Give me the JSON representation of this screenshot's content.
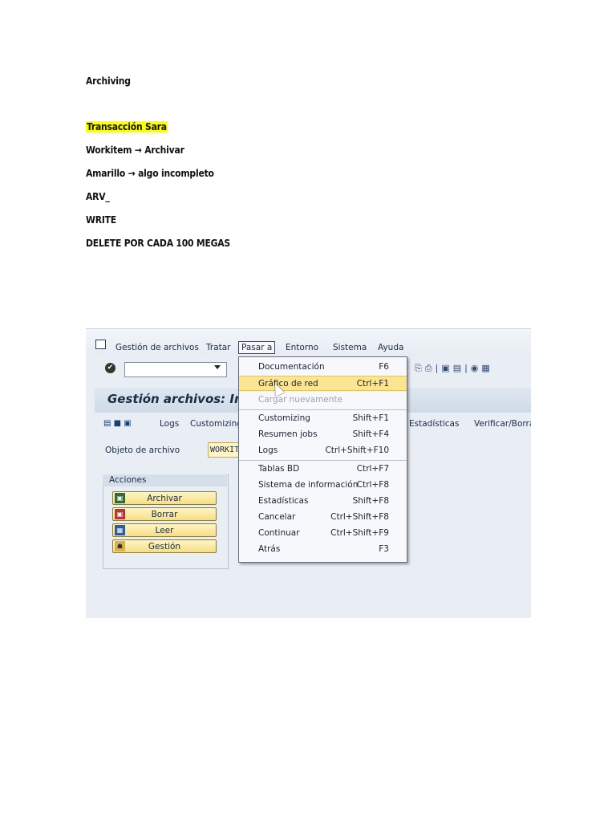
{
  "doc": {
    "heading": "Archiving",
    "highlight": "Transacción Sara",
    "line1": "Workitem → Archivar",
    "line2": "Amarillo → algo incompleto",
    "line3": "ARV_",
    "line4": "WRITE",
    "line5": "DELETE POR CADA 100 MEGAS"
  },
  "sap": {
    "menu": [
      "Gestión de archivos",
      "Tratar",
      "Pasar a",
      "Entorno",
      "Sistema",
      "Ayuda"
    ],
    "title": "Gestión archivos: Ima",
    "app_toolbar": {
      "logs": "Logs",
      "customizing": "Customizing",
      "estadisticas": "Estadísticas",
      "verificar": "Verificar/Borrar"
    },
    "object_label": "Objeto de archivo",
    "object_value": "WORKITEM",
    "actions_title": "Acciones",
    "actions": [
      "Archivar",
      "Borrar",
      "Leer",
      "Gestión"
    ],
    "dropdown": [
      {
        "label": "Documentación",
        "shortcut": "F6"
      },
      {
        "label": "Gráfico de red",
        "shortcut": "Ctrl+F1"
      },
      {
        "label": "Cargar nuevamente",
        "shortcut": ""
      },
      {
        "label": "Customizing",
        "shortcut": "Shift+F1"
      },
      {
        "label": "Resumen jobs",
        "shortcut": "Shift+F4"
      },
      {
        "label": "Logs",
        "shortcut": "Ctrl+Shift+F10"
      },
      {
        "label": "Tablas BD",
        "shortcut": "Ctrl+F7"
      },
      {
        "label": "Sistema de información",
        "shortcut": "Ctrl+F8"
      },
      {
        "label": "Estadísticas",
        "shortcut": "Shift+F8"
      },
      {
        "label": "Cancelar",
        "shortcut": "Ctrl+Shift+F8"
      },
      {
        "label": "Continuar",
        "shortcut": "Ctrl+Shift+F9"
      },
      {
        "label": "Atrás",
        "shortcut": "F3"
      }
    ]
  }
}
